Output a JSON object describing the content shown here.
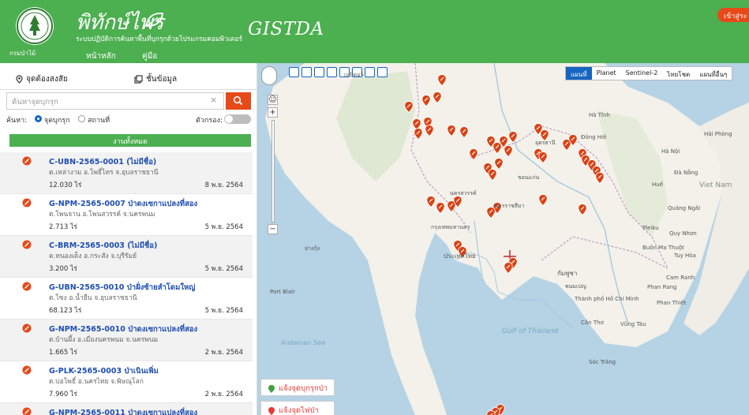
{
  "header": {
    "title": "พิทักษ์ไพร",
    "subtitle": "ระบบปฏิบัติการค้นหาพื้นที่บุกรุกด้วยโปรแกรมคอมพิวเตอร์",
    "department": "กรมป่าไม้",
    "partner": "GISTDA",
    "nav": [
      {
        "label": "หน้าหลัก",
        "active": true
      },
      {
        "label": "คู่มือ",
        "active": false
      }
    ],
    "login_label": "เข้าสู่ระ"
  },
  "sidebar": {
    "tabs": [
      {
        "label": "จุดต้องสงสัย",
        "icon": "location-pin-icon"
      },
      {
        "label": "ชั้นข้อมูล",
        "icon": "layers-icon"
      }
    ],
    "search": {
      "placeholder": "ค้นหาจุดบุกรุก",
      "clear": "×"
    },
    "filter": {
      "label": "ค้นหา:",
      "options": [
        {
          "label": "จุดบุกรุก",
          "selected": true
        },
        {
          "label": "สถานที่",
          "selected": false
        }
      ],
      "toggle_label": "ตัวกรอง:",
      "toggle_on": false
    },
    "all_label": "งานทั้งหมด",
    "items": [
      {
        "title": "C-UBN-2565-0001 (ไม่มีชื่อ)",
        "location": "ต.เหล่างาม อ.โพธิ์ไทร จ.อุบลราชธานี",
        "area": "12.030 ไร่",
        "date": "8 พ.ย. 2564"
      },
      {
        "title": "G-NPM-2565-0007 ป่าดงเซกาแปลงที่สอง",
        "location": "ต.โพนจาน อ.โพนสวรรค์ จ.นครพนม",
        "area": "2.713 ไร่",
        "date": "5 พ.ย. 2564"
      },
      {
        "title": "C-BRM-2565-0003 (ไม่มีชื่อ)",
        "location": "ต.หนองเต็ง อ.กระสัง จ.บุรีรัมย์",
        "area": "3.200 ไร่",
        "date": "5 พ.ย. 2564"
      },
      {
        "title": "G-UBN-2565-0010 ป่าฝั่งซ้ายลำโดมใหญ่",
        "location": "ต.โซง อ.น้ำยืน จ.อุบลราชธานี",
        "area": "68.123 ไร่",
        "date": "5 พ.ย. 2564"
      },
      {
        "title": "G-NPM-2565-0010 ป่าดงเซกาแปลงที่สอง",
        "location": "ต.บ้านผึ้ง อ.เมืองนครพนม จ.นครพนม",
        "area": "1.665 ไร่",
        "date": "2 พ.ย. 2564"
      },
      {
        "title": "G-PLK-2565-0003 ป่าเนินเพิ่ม",
        "location": "ต.บ่อโพธิ์ อ.นครไทย จ.พิษณุโลก",
        "area": "7.960 ไร่",
        "date": "2 พ.ย. 2564"
      },
      {
        "title": "G-NPM-2565-0011 ป่าดงเซกาแปลงที่สอง",
        "location": "",
        "area": "",
        "date": ""
      }
    ]
  },
  "map": {
    "map_types": [
      {
        "label": "แผนที่",
        "active": true
      },
      {
        "label": "Planet",
        "active": false
      },
      {
        "label": "Sentinel-2",
        "active": false
      },
      {
        "label": "ไทยโชต",
        "active": false
      },
      {
        "label": "แผนที่อื่นๆ",
        "active": false
      }
    ],
    "zoom_in": "+",
    "zoom_out": "−",
    "places": [
      "Hà Nội",
      "Hải Phòng",
      "Hà Tĩnh",
      "Đông Hới",
      "Huế",
      "Đà Nẵng",
      "Viet Nam",
      "Quảng Ngãi",
      "Pleiku",
      "Quy Nhơn",
      "Buôn Ma Thuột",
      "Tuy Hòa",
      "Cam Ranh",
      "Phan Rang",
      "Thành phố Hồ Chí Minh",
      "Phan Thiết",
      "Cần Thơ",
      "Vũng Tàu",
      "Sóc Trăng",
      "Port Blair",
      "กรุงเทพมหานคร",
      "ประเทศไทย",
      "นครสวรรค์",
      "อุดรธานี",
      "ขอนแก่น",
      "นครราชสีมา",
      "กัมพูชา",
      "พนมเปญ",
      "ย่างกุ้ง",
      "เนปิดอว์"
    ],
    "seas": [
      "Gulf of Thailand",
      "Andaman Sea"
    ],
    "report_buttons": [
      {
        "label": "แจ้งจุดบุกรุกป่า",
        "icon": "forest-pin-icon"
      },
      {
        "label": "แจ้งจุดไฟป่า",
        "icon": "fire-pin-icon"
      }
    ],
    "accent": "#e64a19",
    "primary": "#4caf50"
  }
}
